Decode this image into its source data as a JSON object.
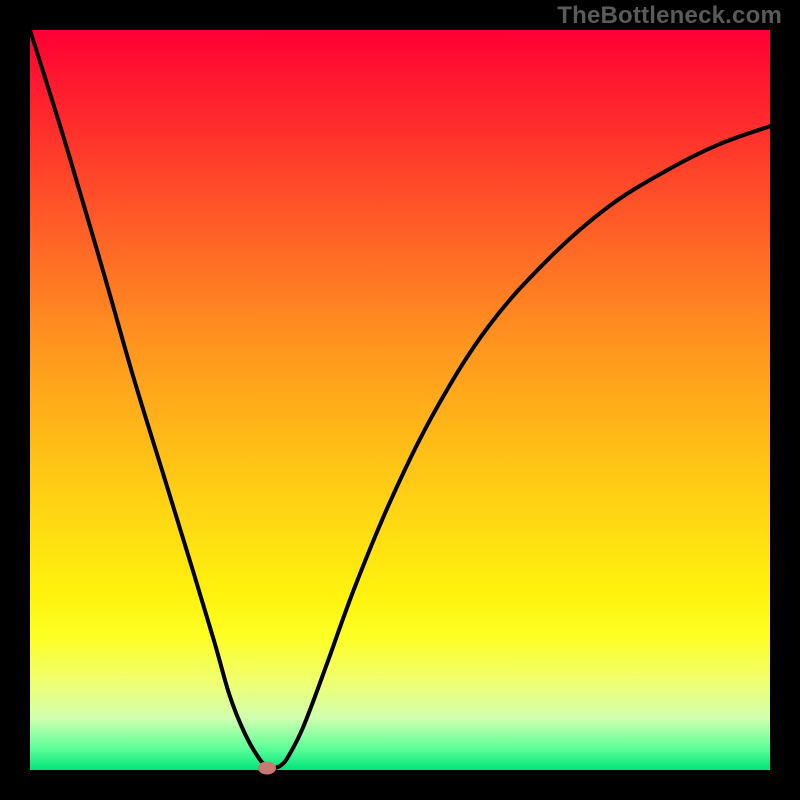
{
  "watermark": "TheBottleneck.com",
  "chart_data": {
    "type": "line",
    "title": "",
    "xlabel": "",
    "ylabel": "",
    "xlim": [
      0,
      100
    ],
    "ylim": [
      0,
      100
    ],
    "grid": false,
    "legend": false,
    "series": [
      {
        "name": "bottleneck-curve",
        "x": [
          0,
          5,
          10,
          14,
          18,
          22,
          25,
          27,
          29,
          31,
          32,
          33,
          34,
          35,
          37,
          40,
          44,
          49,
          55,
          62,
          70,
          78,
          86,
          93,
          100
        ],
        "values": [
          100,
          84,
          67,
          53,
          40,
          27,
          17,
          10,
          5,
          1.5,
          0.7,
          0.3,
          0.7,
          2,
          6,
          14,
          25,
          37,
          49,
          60,
          69,
          76,
          81,
          84.5,
          87
        ]
      }
    ],
    "marker": {
      "x": 32,
      "y": 0.3,
      "color": "#c77a73"
    },
    "gradient_stops": [
      {
        "pos": 0.0,
        "color": "#ff0034"
      },
      {
        "pos": 0.5,
        "color": "#ffb718"
      },
      {
        "pos": 0.8,
        "color": "#fff20d"
      },
      {
        "pos": 1.0,
        "color": "#00e47a"
      }
    ]
  }
}
